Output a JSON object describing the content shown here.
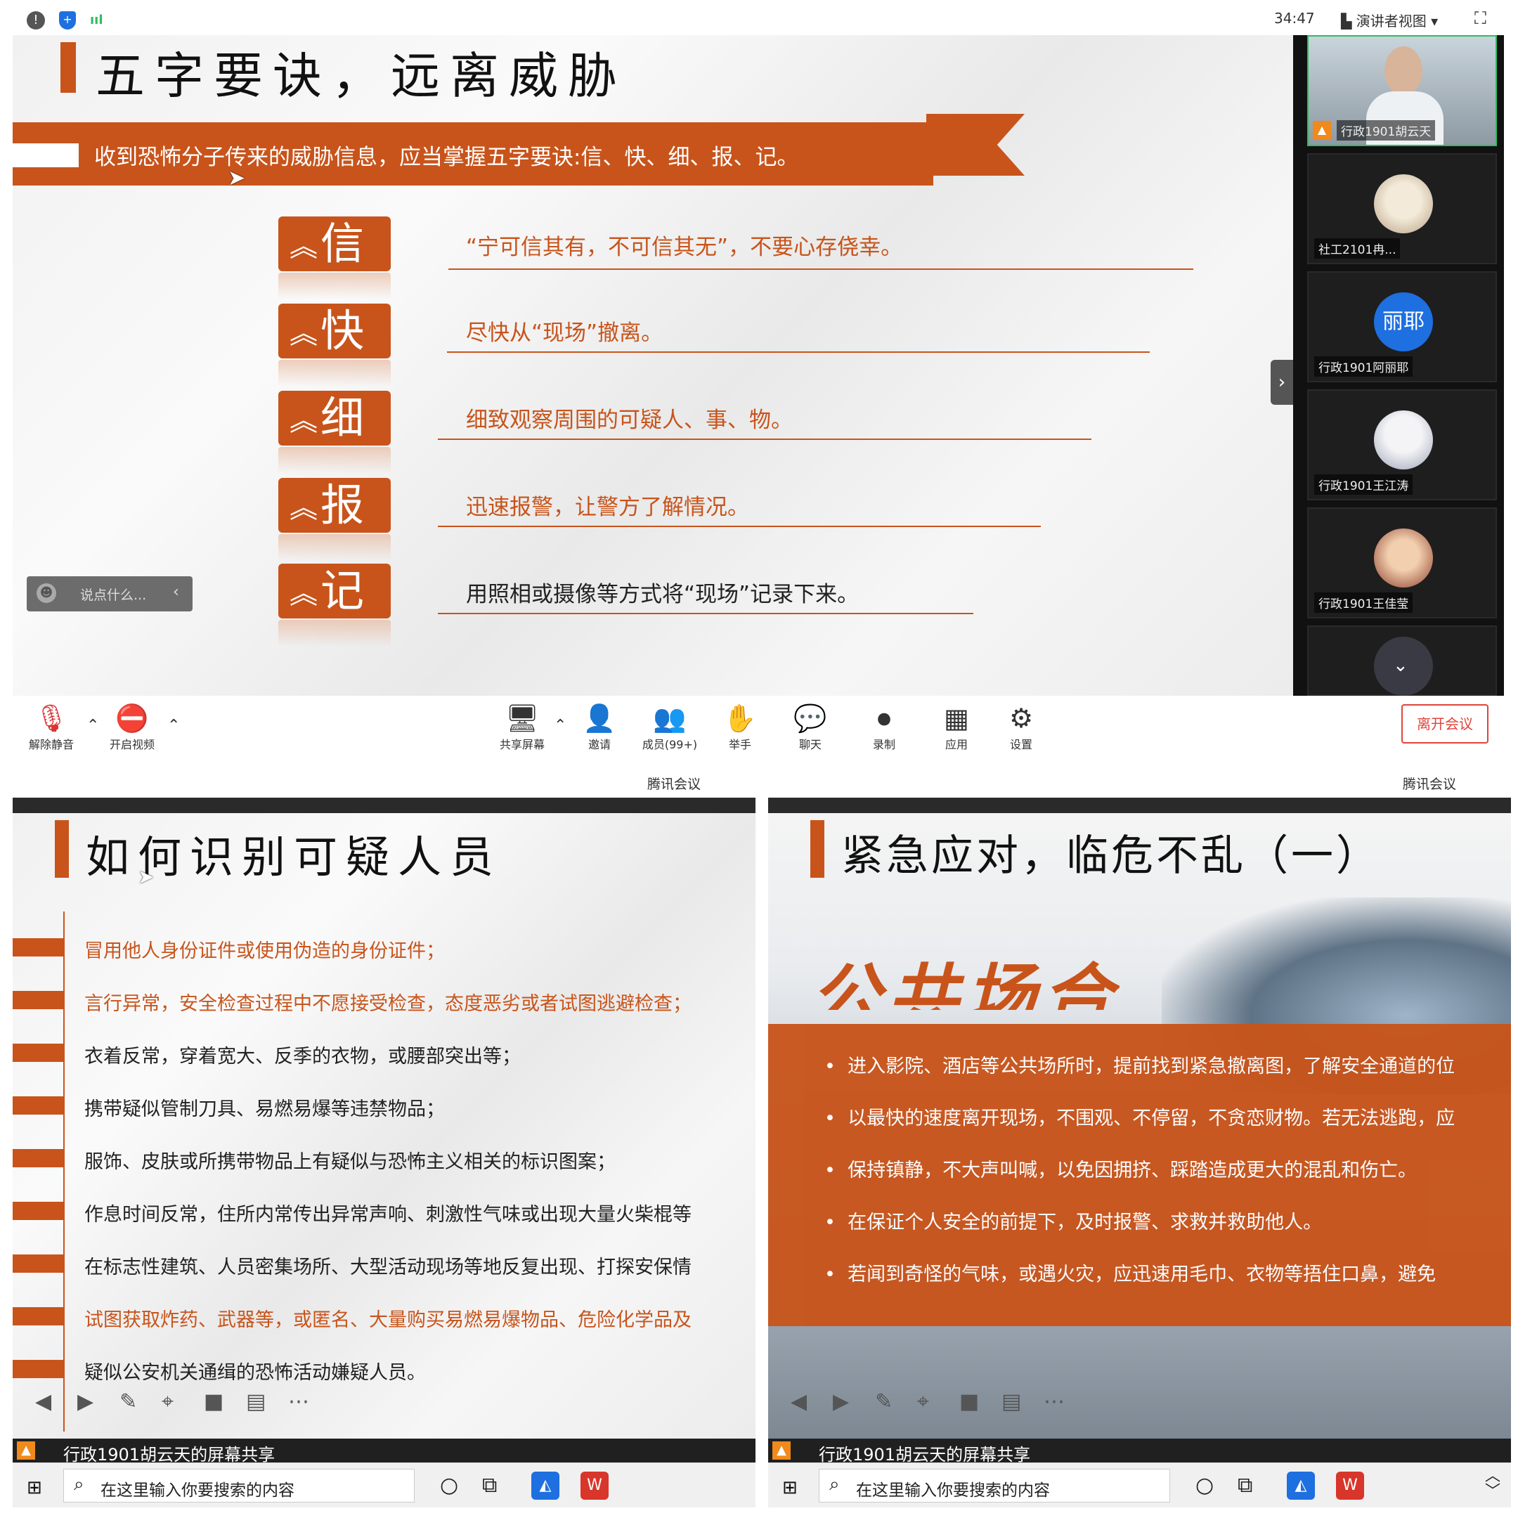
{
  "top": {
    "status_time": "34:47",
    "view_label": "演讲者视图",
    "slide_title": "五字要诀，远离威胁",
    "banner": "收到恐怖分子传来的威胁信息，应当掌握五字要诀:信、快、细、报、记。",
    "tips": [
      {
        "letter": "信",
        "text": "“宁可信其有，不可信其无”，不要心存侥幸。",
        "color": "orange"
      },
      {
        "letter": "快",
        "text": "尽快从“现场”撤离。",
        "color": "orange"
      },
      {
        "letter": "细",
        "text": "细致观察周围的可疑人、事、物。",
        "color": "orange"
      },
      {
        "letter": "报",
        "text": "迅速报警，让警方了解情况。",
        "color": "orange"
      },
      {
        "letter": "记",
        "text": "用照相或摄像等方式将“现场”记录下来。",
        "color": "dark"
      }
    ],
    "chat_placeholder": "说点什么...",
    "participants": [
      {
        "name": "行政1901胡云天"
      },
      {
        "name": "社工2101冉..."
      },
      {
        "name": "行政1901阿丽耶",
        "initials": "丽耶"
      },
      {
        "name": "行政1901王江涛"
      },
      {
        "name": "行政1901王佳莹"
      }
    ]
  },
  "toolbar": {
    "unmute": "解除静音",
    "start_video": "开启视频",
    "share_screen": "共享屏幕",
    "invite": "邀请",
    "members": "成员(99+)",
    "raise_hand": "举手",
    "chat": "聊天",
    "record": "录制",
    "apps": "应用",
    "settings": "设置",
    "leave": "离开会议"
  },
  "bottom_left": {
    "app_label": "腾讯会议",
    "slide_title": "如何识别可疑人员",
    "items": [
      {
        "text": "冒用他人身份证件或使用伪造的身份证件；",
        "color": "orange"
      },
      {
        "text": "言行异常，安全检查过程中不愿接受检查，态度恶劣或者试图逃避检查；",
        "color": "orange"
      },
      {
        "text": "衣着反常，穿着宽大、反季的衣物，或腰部突出等；",
        "color": "dark"
      },
      {
        "text": "携带疑似管制刀具、易燃易爆等违禁物品；",
        "color": "dark"
      },
      {
        "text": "服饰、皮肤或所携带物品上有疑似与恐怖主义相关的标识图案；",
        "color": "dark"
      },
      {
        "text": "作息时间反常，住所内常传出异常声响、刺激性气味或出现大量火柴棍等",
        "color": "dark"
      },
      {
        "text": "在标志性建筑、人员密集场所、大型活动现场等地反复出现、打探安保情",
        "color": "dark"
      },
      {
        "text": "试图获取炸药、武器等，或匿名、大量购买易燃易爆物品、危险化学品及",
        "color": "orange"
      },
      {
        "text": "疑似公安机关通缉的恐怖活动嫌疑人员。",
        "color": "dark"
      }
    ],
    "share_label": "行政1901胡云天的屏幕共享",
    "search_placeholder": "在这里输入你要搜索的内容"
  },
  "bottom_right": {
    "app_label": "腾讯会议",
    "slide_title": "紧急应对，临危不乱（一）",
    "big_heading": "公共场合",
    "bullets": [
      "进入影院、酒店等公共场所时，提前找到紧急撤离图，了解安全通道的位",
      "以最快的速度离开现场，不围观、不停留，不贪恋财物。若无法逃跑，应",
      "保持镇静，不大声叫喊，以免因拥挤、踩踏造成更大的混乱和伤亡。",
      "在保证个人安全的前提下，及时报警、求救并救助他人。",
      "若闻到奇怪的气味，或遇火灾，应迅速用毛巾、衣物等捂住口鼻，避免"
    ],
    "share_label": "行政1901胡云天的屏幕共享",
    "search_placeholder": "在这里输入你要搜索的内容"
  },
  "colors": {
    "accent": "#c8541b",
    "active_tile": "#2dbe5f",
    "leave_red": "#e0443a"
  }
}
